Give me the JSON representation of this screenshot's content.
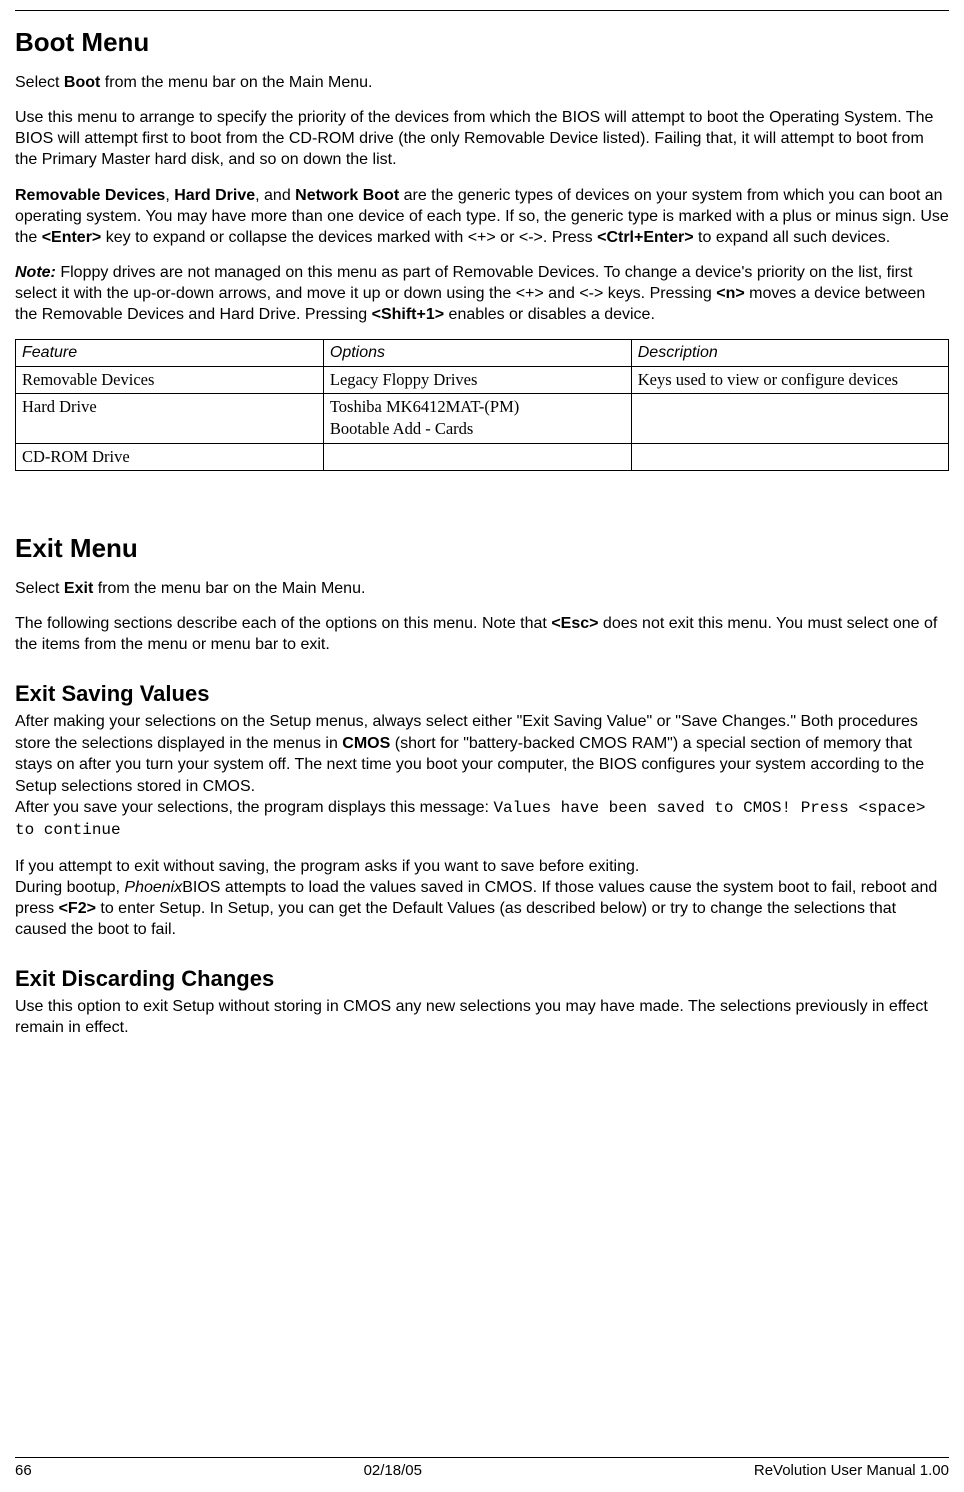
{
  "boot": {
    "heading": "Boot Menu",
    "p1_a": "Select ",
    "p1_b": "Boot",
    "p1_c": " from the menu bar on the Main Menu.",
    "p2": "Use this menu to arrange to specify the priority of the devices from which the BIOS will attempt to boot the Operating System. The BIOS will attempt first to boot from the CD-ROM drive (the only Removable Device listed). Failing that, it will attempt to boot from the Primary Master hard disk, and so on down the list.",
    "p3_a": "Removable Devices",
    "p3_b": ", ",
    "p3_c": "Hard Drive",
    "p3_d": ", and ",
    "p3_e": "Network Boot",
    "p3_f": " are the generic types of devices on your system from which you can boot an operating system. You may have more than one device of each type. If so, the generic type is marked with a plus or minus sign. Use the ",
    "p3_g": "<Enter>",
    "p3_h": " key to expand or collapse the devices marked with <+> or <->. Press ",
    "p3_i": "<Ctrl+Enter>",
    "p3_j": " to expand all such devices.",
    "p4_a": "Note:",
    "p4_b": " Floppy drives are not managed on this menu as part of Removable Devices. To change a device's priority on the list, first select it with the up-or-down arrows, and move it up or down using the <+> and <-> keys. Pressing ",
    "p4_c": "<n>",
    "p4_d": " moves a device between the Removable Devices and Hard Drive. Pressing ",
    "p4_e": "<Shift+1>",
    "p4_f": " enables or disables a device."
  },
  "table": {
    "headers": {
      "feature": "Feature",
      "options": "Options",
      "description": "Description"
    },
    "rows": [
      {
        "feature": "Removable Devices",
        "opt1": "Legacy Floppy Drives",
        "opt2": "",
        "desc": "Keys used to view or configure devices"
      },
      {
        "feature": "Hard Drive",
        "opt1": "Toshiba MK6412MAT-(PM)",
        "opt2": "Bootable Add - Cards",
        "desc": ""
      },
      {
        "feature": "CD-ROM Drive",
        "opt1": "",
        "opt2": "",
        "desc": ""
      }
    ]
  },
  "exit": {
    "heading": "Exit Menu",
    "p1_a": "Select ",
    "p1_b": "Exit",
    "p1_c": " from the menu bar on the Main Menu.",
    "p2_a": "The following sections describe each of the options on this menu. Note that ",
    "p2_b": "<Esc>",
    "p2_c": " does not exit this menu. You must select one of the items from the menu or menu bar to exit."
  },
  "esv": {
    "heading": "Exit Saving Values",
    "p1_a": "After making your selections on the Setup menus, always select either \"Exit Saving Value\" or \"Save Changes.\" Both procedures store the selections displayed in the menus in ",
    "p1_b": "CMOS",
    "p1_c": " (short for \"battery-backed CMOS RAM\") a special section of memory that stays on after you turn your system off. The next time you boot your computer, the BIOS configures your system according to the Setup selections stored in CMOS.",
    "p2_a": "After you save your selections, the program displays this message: ",
    "p2_b": "Values have been saved to CMOS! Press <space> to continue",
    "p3": "If you attempt to exit without saving, the program asks if you want to save before exiting.",
    "p4_a": "During bootup, ",
    "p4_b": "Phoenix",
    "p4_c": "BIOS attempts to load the values saved in CMOS. If those values cause the system boot to fail, reboot and press ",
    "p4_d": "<F2>",
    "p4_e": " to enter Setup. In Setup, you can get the Default Values (as described below) or try to change the selections that caused the boot to fail."
  },
  "edc": {
    "heading": "Exit Discarding Changes",
    "p1": "Use this option to exit Setup without storing in CMOS any new selections you may have made. The selections previously in effect remain in effect."
  },
  "footer": {
    "page": "66",
    "date": "02/18/05",
    "title": "ReVolution User Manual 1.00"
  }
}
